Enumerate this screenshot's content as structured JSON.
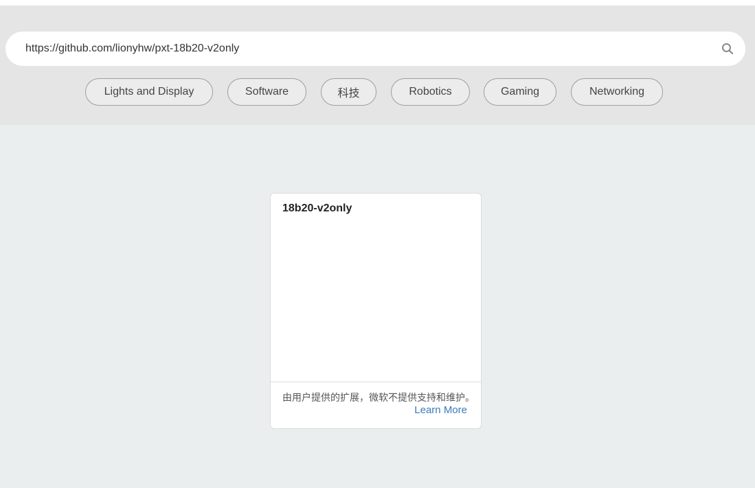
{
  "search": {
    "value": "https://github.com/lionyhw/pxt-18b20-v2only",
    "icon": "search-icon"
  },
  "categories": [
    "Lights and Display",
    "Software",
    "科技",
    "Robotics",
    "Gaming",
    "Networking"
  ],
  "card": {
    "title": "18b20-v2only",
    "disclaimer": "由用户提供的扩展，微软不提供支持和维护。",
    "learn_more": "Learn More"
  },
  "colors": {
    "top_band": "#e5e5e5",
    "content_background": "#ebeeef",
    "link": "#3a7ab8"
  }
}
